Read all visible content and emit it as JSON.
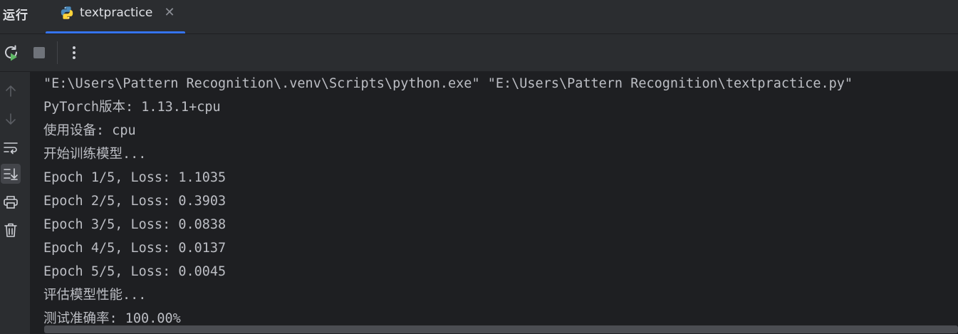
{
  "header": {
    "run_title": "运行",
    "tab": {
      "label": "textpractice",
      "icon": "python-icon",
      "close_glyph": "✕"
    }
  },
  "toolbar": {
    "buttons": [
      {
        "name": "rerun-icon"
      },
      {
        "name": "stop-icon"
      },
      {
        "name": "more-options-icon",
        "glyph": "⋮"
      }
    ]
  },
  "gutter": {
    "buttons": [
      {
        "name": "scroll-up-icon"
      },
      {
        "name": "scroll-down-icon"
      },
      {
        "name": "soft-wrap-icon"
      },
      {
        "name": "scroll-to-end-icon",
        "active": true
      },
      {
        "name": "print-icon"
      },
      {
        "name": "clear-icon"
      }
    ]
  },
  "console": {
    "lines": [
      "\"E:\\Users\\Pattern Recognition\\.venv\\Scripts\\python.exe\" \"E:\\Users\\Pattern Recognition\\textpractice.py\"",
      "PyTorch版本: 1.13.1+cpu",
      "使用设备: cpu",
      "开始训练模型...",
      "Epoch 1/5, Loss: 1.1035",
      "Epoch 2/5, Loss: 0.3903",
      "Epoch 3/5, Loss: 0.0838",
      "Epoch 4/5, Loss: 0.0137",
      "Epoch 5/5, Loss: 0.0045",
      "评估模型性能...",
      "测试准确率: 100.00%"
    ]
  },
  "colors": {
    "accent": "#3574f0",
    "panel": "#2b2d30",
    "console_bg": "#1e1f22",
    "text": "#bcbec4",
    "run_green": "#5fb865"
  }
}
